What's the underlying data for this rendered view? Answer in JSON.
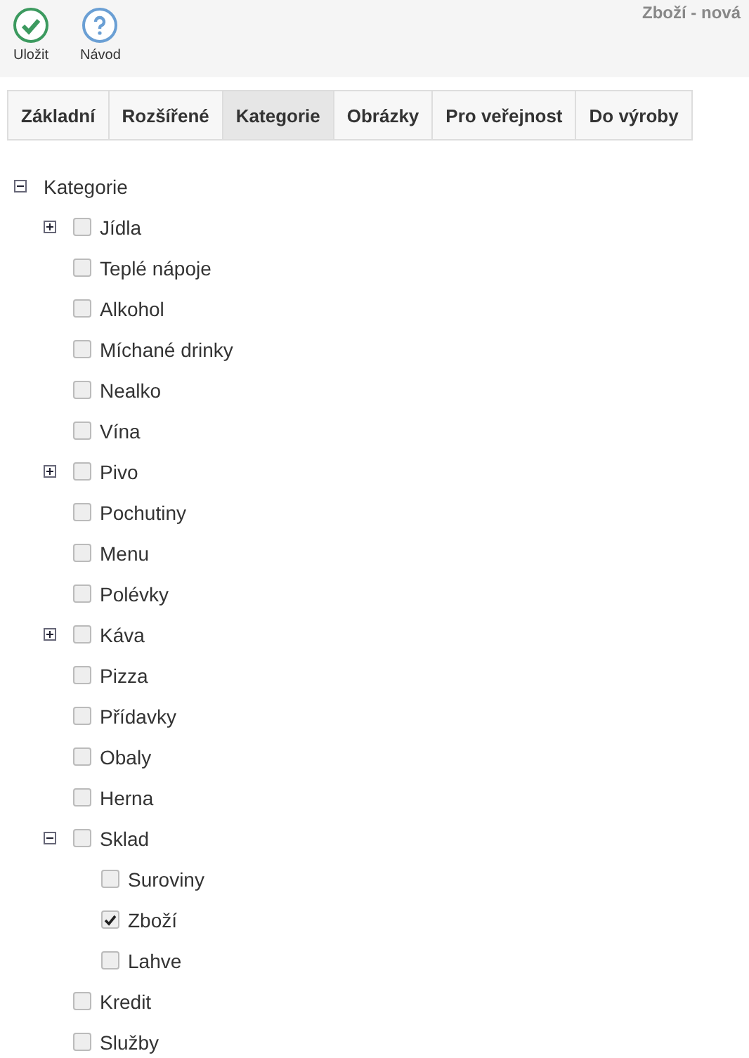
{
  "toolbar": {
    "title": "Zboží - nová",
    "buttons": [
      {
        "kind": "save",
        "label": "Uložit"
      },
      {
        "kind": "help",
        "label": "Návod"
      }
    ]
  },
  "tabs": [
    {
      "label": "Základní",
      "selected": false
    },
    {
      "label": "Rozšířené",
      "selected": false
    },
    {
      "label": "Kategorie",
      "selected": true
    },
    {
      "label": "Obrázky",
      "selected": false
    },
    {
      "label": "Pro veřejnost",
      "selected": false
    },
    {
      "label": "Do výroby",
      "selected": false
    }
  ],
  "tree": {
    "label": "Kategorie",
    "expanded": true,
    "children": [
      {
        "label": "Jídla",
        "checked": false,
        "expanded": false
      },
      {
        "label": "Teplé nápoje",
        "checked": false
      },
      {
        "label": "Alkohol",
        "checked": false
      },
      {
        "label": "Míchané drinky",
        "checked": false
      },
      {
        "label": "Nealko",
        "checked": false
      },
      {
        "label": "Vína",
        "checked": false
      },
      {
        "label": "Pivo",
        "checked": false,
        "expanded": false
      },
      {
        "label": "Pochutiny",
        "checked": false
      },
      {
        "label": "Menu",
        "checked": false
      },
      {
        "label": "Polévky",
        "checked": false
      },
      {
        "label": "Káva",
        "checked": false,
        "expanded": false
      },
      {
        "label": "Pizza",
        "checked": false
      },
      {
        "label": "Přídavky",
        "checked": false
      },
      {
        "label": "Obaly",
        "checked": false
      },
      {
        "label": "Herna",
        "checked": false
      },
      {
        "label": "Sklad",
        "checked": false,
        "expanded": true,
        "children": [
          {
            "label": "Suroviny",
            "checked": false
          },
          {
            "label": "Zboží",
            "checked": true
          },
          {
            "label": "Lahve",
            "checked": false
          }
        ]
      },
      {
        "label": "Kredit",
        "checked": false
      },
      {
        "label": "Služby",
        "checked": false
      }
    ]
  }
}
